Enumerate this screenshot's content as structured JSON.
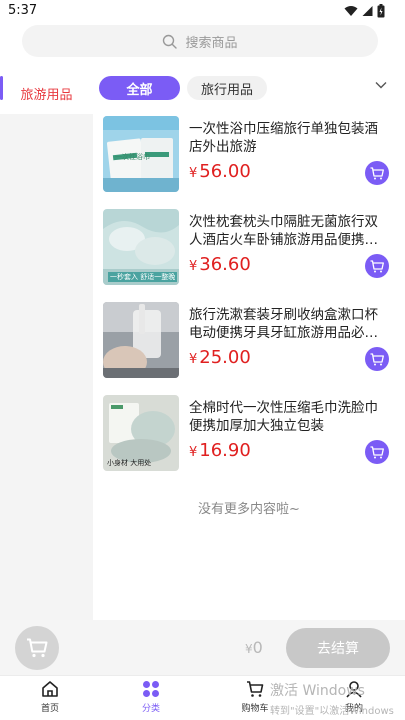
{
  "status_bar": {
    "time": "5:37"
  },
  "search": {
    "placeholder": "搜索商品"
  },
  "sidebar": {
    "items": [
      {
        "label": "旅游用品",
        "selected": true
      }
    ]
  },
  "tabs": [
    {
      "label": "全部",
      "active": true
    },
    {
      "label": "旅行用品",
      "active": false
    }
  ],
  "products": [
    {
      "name": "一次性浴巾压缩旅行单独包装酒店外出旅游",
      "price": "56.00",
      "image": "compressed-towel-package",
      "image_text": "一次性浴巾"
    },
    {
      "name": "次性枕套枕头巾隔脏无菌旅行双人酒店火车卧铺旅游用品便携…",
      "price": "36.60",
      "image": "pillowcase-photo",
      "image_text": "一秒套入 舒适一整晚"
    },
    {
      "name": "旅行洗漱套装牙刷收纳盒漱口杯电动便携牙具牙缸旅游用品必…",
      "price": "25.00",
      "image": "toiletry-cup-photo",
      "image_text": ""
    },
    {
      "name": "全棉时代一次性压缩毛巾洗脸巾便携加厚加大独立包装",
      "price": "16.90",
      "image": "cotton-towel-photo",
      "image_text": "小身材 大用处"
    }
  ],
  "currency": "¥",
  "footer_text": "没有更多内容啦~",
  "checkout": {
    "total": "0",
    "button_label": "去结算"
  },
  "bottom_nav": [
    {
      "label": "首页",
      "icon": "home-icon",
      "active": false
    },
    {
      "label": "分类",
      "icon": "category-icon",
      "active": true
    },
    {
      "label": "购物车",
      "icon": "cart-icon",
      "active": false
    },
    {
      "label": "我的",
      "icon": "user-icon",
      "active": false
    }
  ],
  "watermark": {
    "line1": "激活 Windows",
    "line2": "转到\"设置\"以激活Windows"
  },
  "colors": {
    "accent": "#7b5cf5",
    "price": "#e02020",
    "sidebar_active_text": "#e8393f"
  }
}
